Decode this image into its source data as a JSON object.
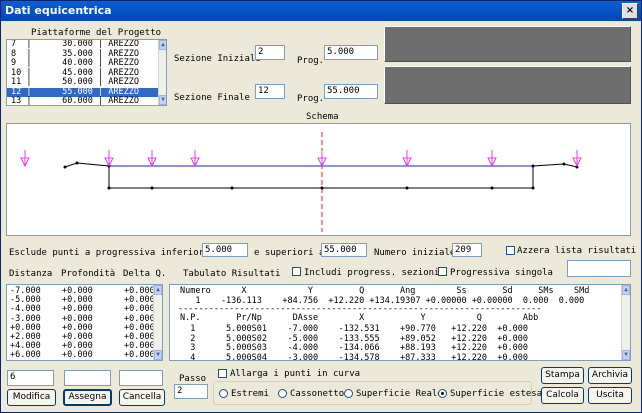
{
  "window": {
    "title": "Dati equicentrica",
    "close_glyph": "×"
  },
  "platforms": {
    "title": "Piattaforme del Progetto",
    "rows": [
      "7  |      30.000 | AREZZO",
      "8  |      35.000 | AREZZO",
      "9  |      40.000 | AREZZO",
      "10 |      45.000 | AREZZO",
      "11 |      50.000 | AREZZO",
      "12 |      55.000 | AREZZO",
      "13 |      60.000 | AREZZO"
    ],
    "selected_index": 5
  },
  "sections": {
    "start_label": "Sezione Iniziale",
    "start_value": "2",
    "prog_label_1": "Prog.",
    "prog_value_1": "5.000",
    "end_label": "Sezione Finale",
    "end_value": "12",
    "prog_label_2": "Prog.",
    "prog_value_2": "55.000"
  },
  "schema": {
    "title": "Schema"
  },
  "filters": {
    "exclude_label": "Esclude punti a progressiva inferiore a",
    "exclude_min": "5.000",
    "and_above_label": "e superiori a",
    "exclude_max": "55.000",
    "initial_number_label": "Numero iniziale",
    "initial_number": "209",
    "reset_results_label": "Azzera lista risultati"
  },
  "distances": {
    "headers": [
      "Distanza",
      "Profondità",
      "Delta Q."
    ],
    "rows": [
      [
        "-7.000",
        "+0.000",
        "+0.000"
      ],
      [
        "-5.000",
        "+0.000",
        "+0.000"
      ],
      [
        "-4.000",
        "+0.000",
        "+0.000"
      ],
      [
        "-3.000",
        "+0.000",
        "+0.000"
      ],
      [
        "+0.000",
        "+0.000",
        "+0.000"
      ],
      [
        "+2.000",
        "+0.000",
        "+0.000"
      ],
      [
        "+4.000",
        "+0.000",
        "+0.000"
      ],
      [
        "+6.000",
        "+0.000",
        "+0.000"
      ]
    ]
  },
  "results": {
    "title": "Tabulato Risultati",
    "include_progress_label": "Includi progress. sezioni",
    "single_progress_label": "Progressiva singola",
    "header1": "Numero      X            Y         Q       Ang        Ss       Sd     SMs    SMd",
    "line1": "   1    -136.113    +84.756  +12.220 +134.19307 +0.00000 +0.00000  0.000  0.000",
    "separator": "-----------------------------------------------------------------------",
    "header2": "N.P.       Pr/Np      DAsse        X           Y          Q        Abb",
    "rows": [
      "  1      5.000S01    -7.000    -132.531    +90.770   +12.220  +0.000",
      "  2      5.000S02    -5.000    -133.555    +89.052   +12.220  +0.000",
      "  3      5.000S03    -4.000    -134.066    +88.193   +12.220  +0.000",
      "  4      5.000S04    -3.000    -134.578    +87.333   +12.220  +0.000"
    ]
  },
  "edit": {
    "field1": "6",
    "field2": "",
    "field3": ""
  },
  "buttons": {
    "modifica": "Modifica",
    "assegna": "Assegna",
    "cancella": "Cancella",
    "stampa": "Stampa",
    "archivia": "Archivia",
    "calcola": "Calcola",
    "uscita": "Uscita"
  },
  "passo": {
    "label": "Passo",
    "value": "2"
  },
  "curve": {
    "widen_label": "Allarga i punti in curva",
    "options": [
      "Estremi",
      "Cassonetto",
      "Superficie Reale",
      "Superficie estesa"
    ],
    "selected_index": 3
  },
  "colors": {
    "accent": "#316ac5",
    "arrow": "#e040e0",
    "axis": "#e02020",
    "line": "#2020c0"
  }
}
